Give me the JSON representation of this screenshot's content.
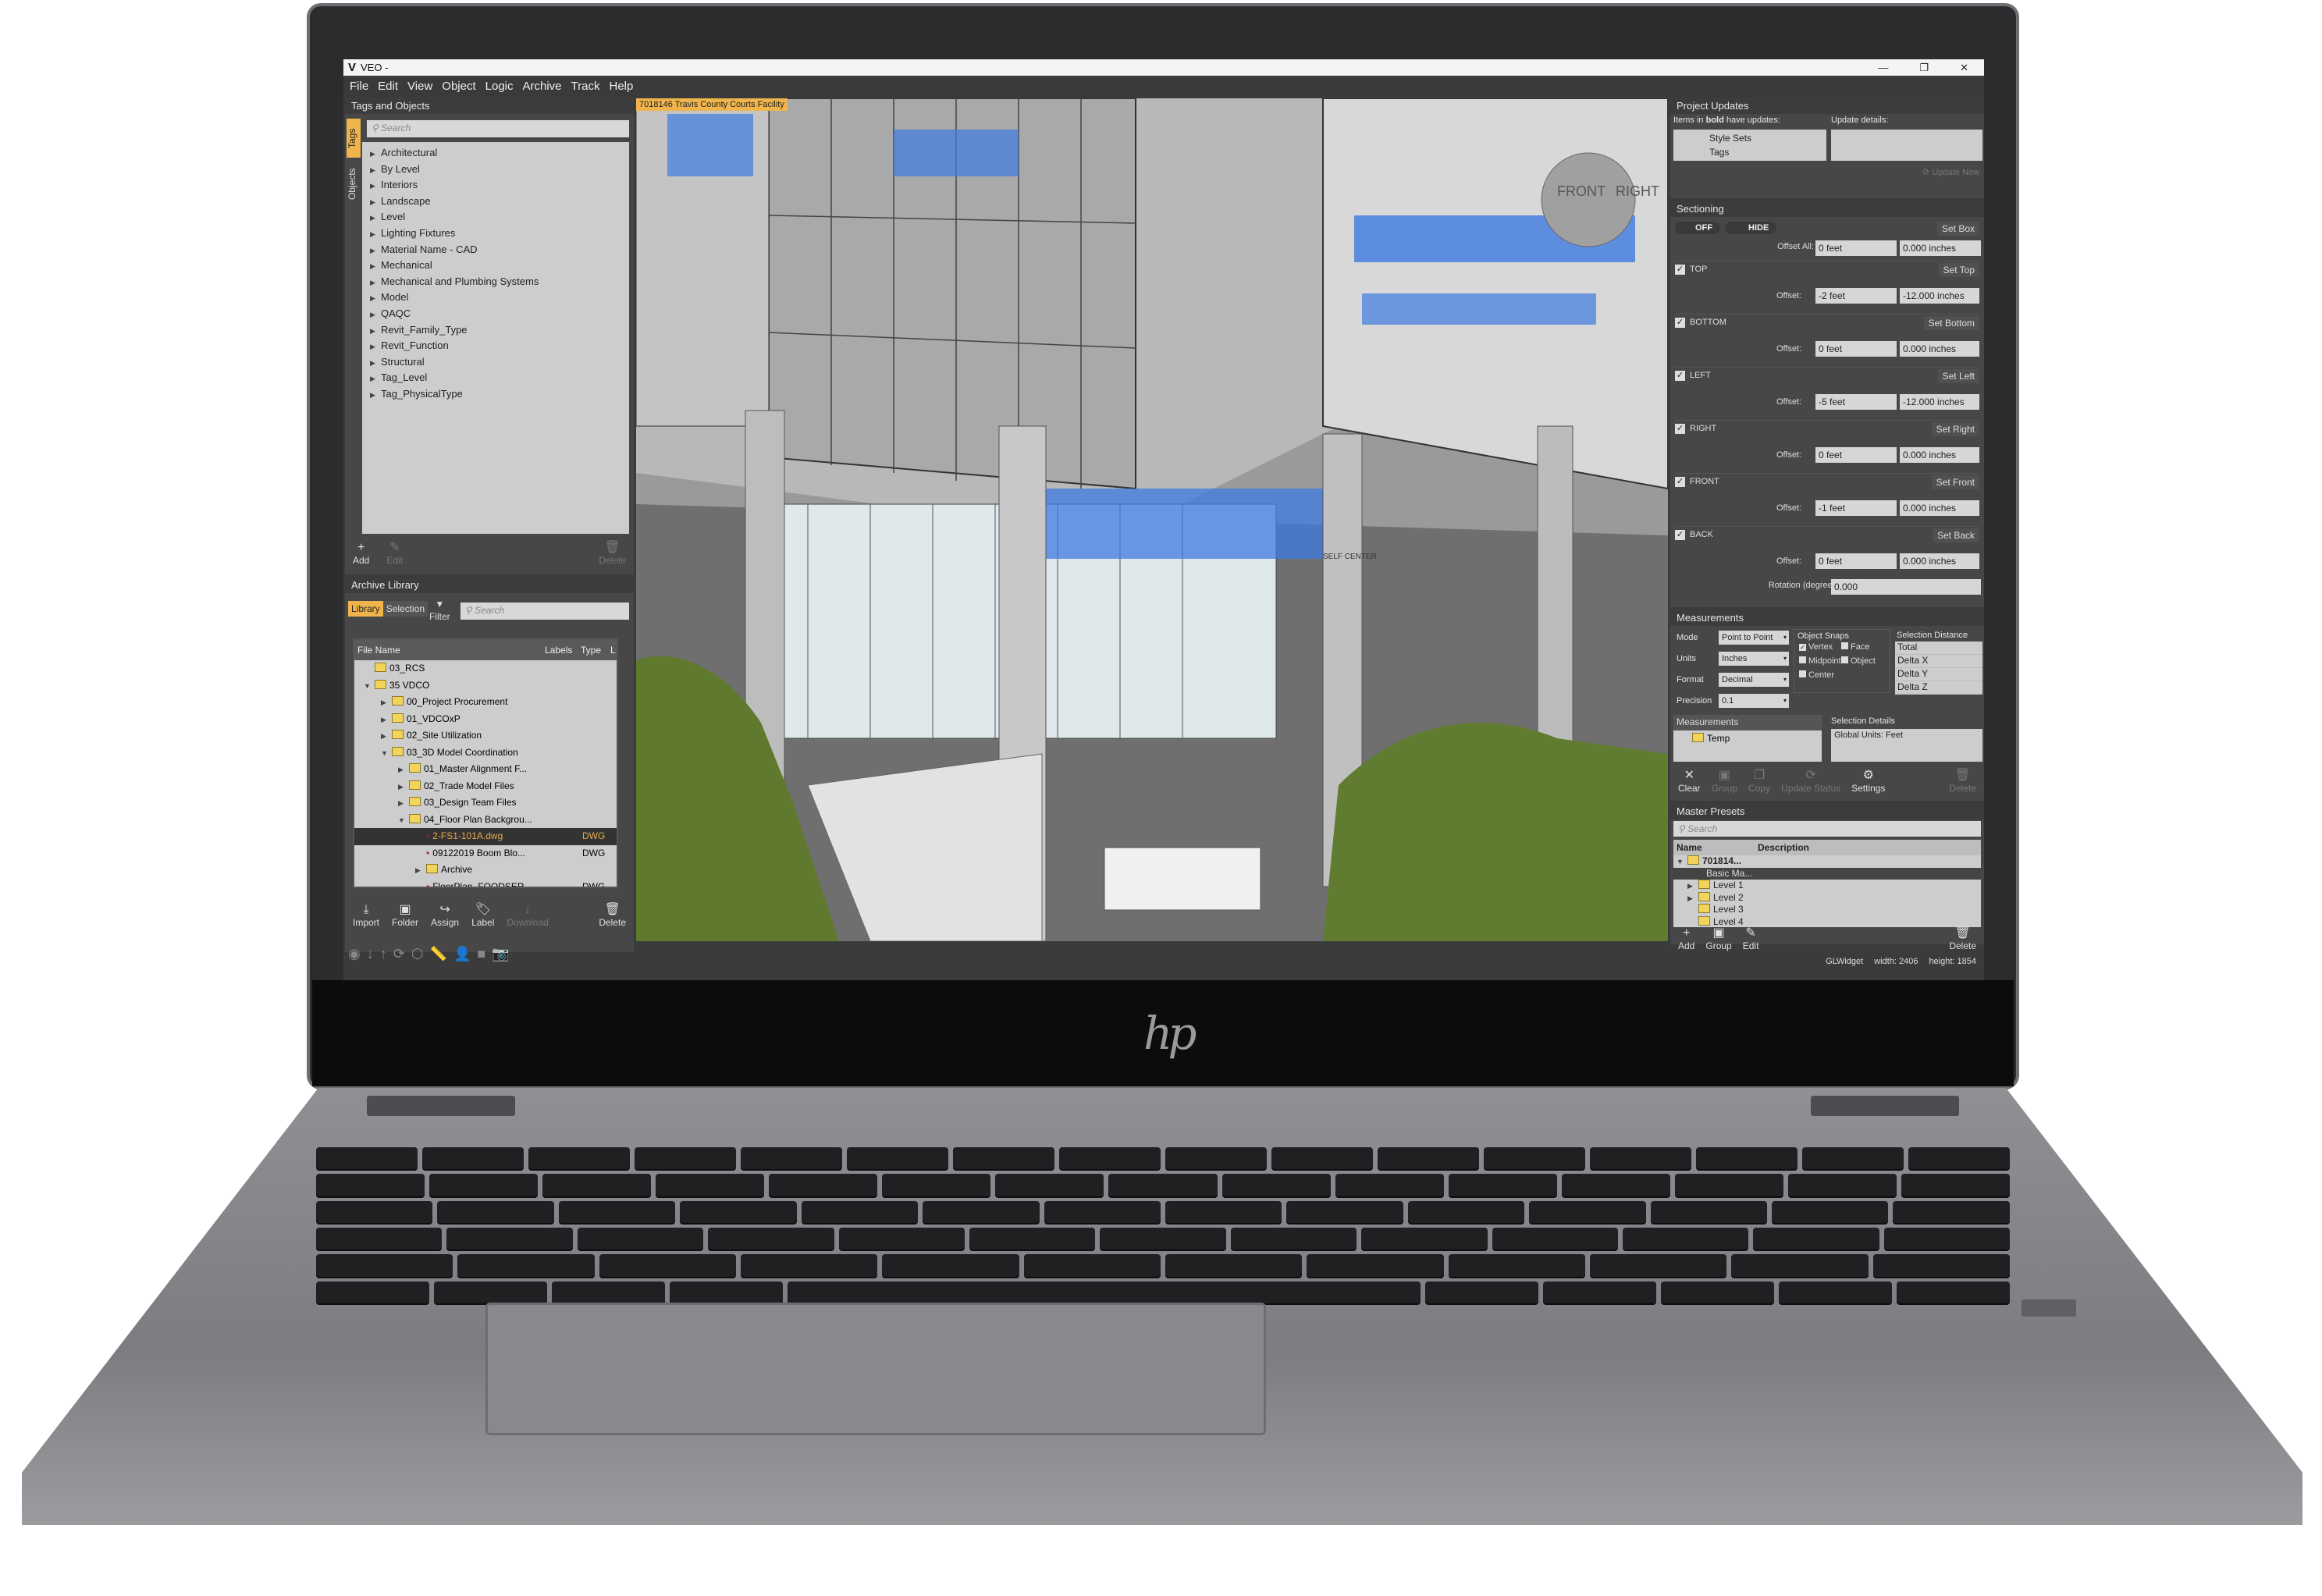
{
  "window": {
    "title": "VEO -",
    "controls": [
      "—",
      "❐",
      "✕"
    ]
  },
  "menu": [
    "File",
    "Edit",
    "View",
    "Object",
    "Logic",
    "Archive",
    "Track",
    "Help"
  ],
  "tags_panel": {
    "title": "Tags and Objects",
    "side_tabs": [
      "Tags",
      "Objects"
    ],
    "search_placeholder": "Search",
    "items": [
      "Architectural",
      "By Level",
      "Interiors",
      "Landscape",
      "Level",
      "Lighting Fixtures",
      "Material Name - CAD",
      "Mechanical",
      "Mechanical and Plumbing Systems",
      "Model",
      "QAQC",
      "Revit_Family_Type",
      "Revit_Function",
      "Structural",
      "Tag_Level",
      "Tag_PhysicalType"
    ],
    "buttons": {
      "add": "Add",
      "edit": "Edit",
      "delete": "Delete"
    }
  },
  "archive": {
    "title": "Archive Library",
    "tabs": [
      "Library",
      "Selection"
    ],
    "filter": "Filter",
    "search_placeholder": "Search",
    "columns": [
      "File Name",
      "Labels",
      "Type",
      "L"
    ],
    "rows": [
      {
        "name": "03_RCS",
        "type": "",
        "kind": "folder",
        "depth": 1,
        "exp": ""
      },
      {
        "name": "35 VDCO",
        "type": "",
        "kind": "folder",
        "depth": 1,
        "exp": "▼"
      },
      {
        "name": "00_Project Procurement",
        "type": "",
        "kind": "folder",
        "depth": 2,
        "exp": "▶"
      },
      {
        "name": "01_VDCOxP",
        "type": "",
        "kind": "folder",
        "depth": 2,
        "exp": "▶"
      },
      {
        "name": "02_Site Utilization",
        "type": "",
        "kind": "folder",
        "depth": 2,
        "exp": "▶"
      },
      {
        "name": "03_3D Model Coordination",
        "type": "",
        "kind": "folder",
        "depth": 2,
        "exp": "▼"
      },
      {
        "name": "01_Master Alignment F...",
        "type": "",
        "kind": "folder",
        "depth": 3,
        "exp": "▶"
      },
      {
        "name": "02_Trade Model Files",
        "type": "",
        "kind": "folder",
        "depth": 3,
        "exp": "▶"
      },
      {
        "name": "03_Design Team Files",
        "type": "",
        "kind": "folder",
        "depth": 3,
        "exp": "▶"
      },
      {
        "name": "04_Floor Plan Backgrou...",
        "type": "",
        "kind": "folder",
        "depth": 3,
        "exp": "▼"
      },
      {
        "name": "2-FS1-101A.dwg",
        "type": "DWG",
        "kind": "file",
        "depth": 4,
        "exp": "",
        "selected": true
      },
      {
        "name": "09122019 Boom Blo...",
        "type": "DWG",
        "kind": "file",
        "depth": 4,
        "exp": ""
      },
      {
        "name": "Archive",
        "type": "",
        "kind": "folder",
        "depth": 4,
        "exp": "▶"
      },
      {
        "name": "FloorPlan_FOODSER...",
        "type": "DWG",
        "kind": "file",
        "depth": 4,
        "exp": ""
      }
    ],
    "buttons": [
      "Import",
      "Folder",
      "Assign",
      "Label",
      "Download",
      "Delete"
    ]
  },
  "viewport": {
    "tab": "7018146 Travis County Courts Facility",
    "viewcube": [
      "FRONT",
      "RIGHT"
    ],
    "sign": "SELF CENTER"
  },
  "project_updates": {
    "title": "Project Updates",
    "items_label_pre": "Items in ",
    "items_label_bold": "bold",
    "items_label_post": " have updates:",
    "details_label": "Update details:",
    "items": [
      "Style Sets",
      "Tags"
    ],
    "update_now": "Update Now"
  },
  "sectioning": {
    "title": "Sectioning",
    "toggle_off": "OFF",
    "toggle_hide": "HIDE",
    "set_box": "Set Box",
    "offset_all_label": "Offset All:",
    "offset_all": [
      "0 feet",
      "0.000 inches"
    ],
    "sides": [
      {
        "name": "TOP",
        "set": "Set Top",
        "feet": "-2 feet",
        "inches": "-12.000 inches"
      },
      {
        "name": "BOTTOM",
        "set": "Set Bottom",
        "feet": "0 feet",
        "inches": "0.000 inches"
      },
      {
        "name": "LEFT",
        "set": "Set Left",
        "feet": "-5 feet",
        "inches": "-12.000 inches"
      },
      {
        "name": "RIGHT",
        "set": "Set Right",
        "feet": "0 feet",
        "inches": "0.000 inches"
      },
      {
        "name": "FRONT",
        "set": "Set Front",
        "feet": "-1 feet",
        "inches": "0.000 inches"
      },
      {
        "name": "BACK",
        "set": "Set Back",
        "feet": "0 feet",
        "inches": "0.000 inches"
      }
    ],
    "offset_label": "Offset:",
    "rotation_label": "Rotation (degrees):",
    "rotation": "0.000"
  },
  "measurements": {
    "title": "Measurements",
    "mode_label": "Mode",
    "mode": "Point to Point",
    "units_label": "Units",
    "units": "Inches",
    "format_label": "Format",
    "format": "Decimal",
    "precision_label": "Precision",
    "precision": "0.1",
    "snaps_title": "Object Snaps",
    "snaps": [
      {
        "label": "Vertex",
        "checked": true
      },
      {
        "label": "Face",
        "checked": false
      },
      {
        "label": "Midpoint",
        "checked": false
      },
      {
        "label": "Object",
        "checked": false
      },
      {
        "label": "Center",
        "checked": false
      }
    ],
    "distance_title": "Selection Distance",
    "distance_rows": [
      "Total",
      "Delta X",
      "Delta Y",
      "Delta Z"
    ],
    "list_title": "Measurements",
    "list_items": [
      "Temp"
    ],
    "details_title": "Selection Details",
    "details": "Global Units: Feet",
    "buttons": [
      "Clear",
      "Group",
      "Copy",
      "Update Status",
      "Settings",
      "Delete"
    ]
  },
  "presets": {
    "title": "Master Presets",
    "search_placeholder": "Search",
    "columns": [
      "Name",
      "Description"
    ],
    "rows": [
      {
        "name": "701814...",
        "exp": "▼",
        "folder": true,
        "bold": true
      },
      {
        "name": "Basic Ma...",
        "exp": "",
        "folder": false,
        "selected": true
      },
      {
        "name": "Level 1",
        "exp": "▶",
        "folder": true
      },
      {
        "name": "Level 2",
        "exp": "▶",
        "folder": true
      },
      {
        "name": "Level 3",
        "exp": "",
        "folder": true
      },
      {
        "name": "Level 4",
        "exp": "",
        "folder": true
      }
    ],
    "buttons": [
      "Add",
      "Group",
      "Edit",
      "Delete"
    ]
  },
  "status": {
    "widget": "GLWidget",
    "width": "width: 2406",
    "height": "height: 1854"
  },
  "colors": {
    "accent": "#f0b44c",
    "panel": "#474747",
    "list": "#cdcdcd",
    "folder": "#f3d45b"
  }
}
